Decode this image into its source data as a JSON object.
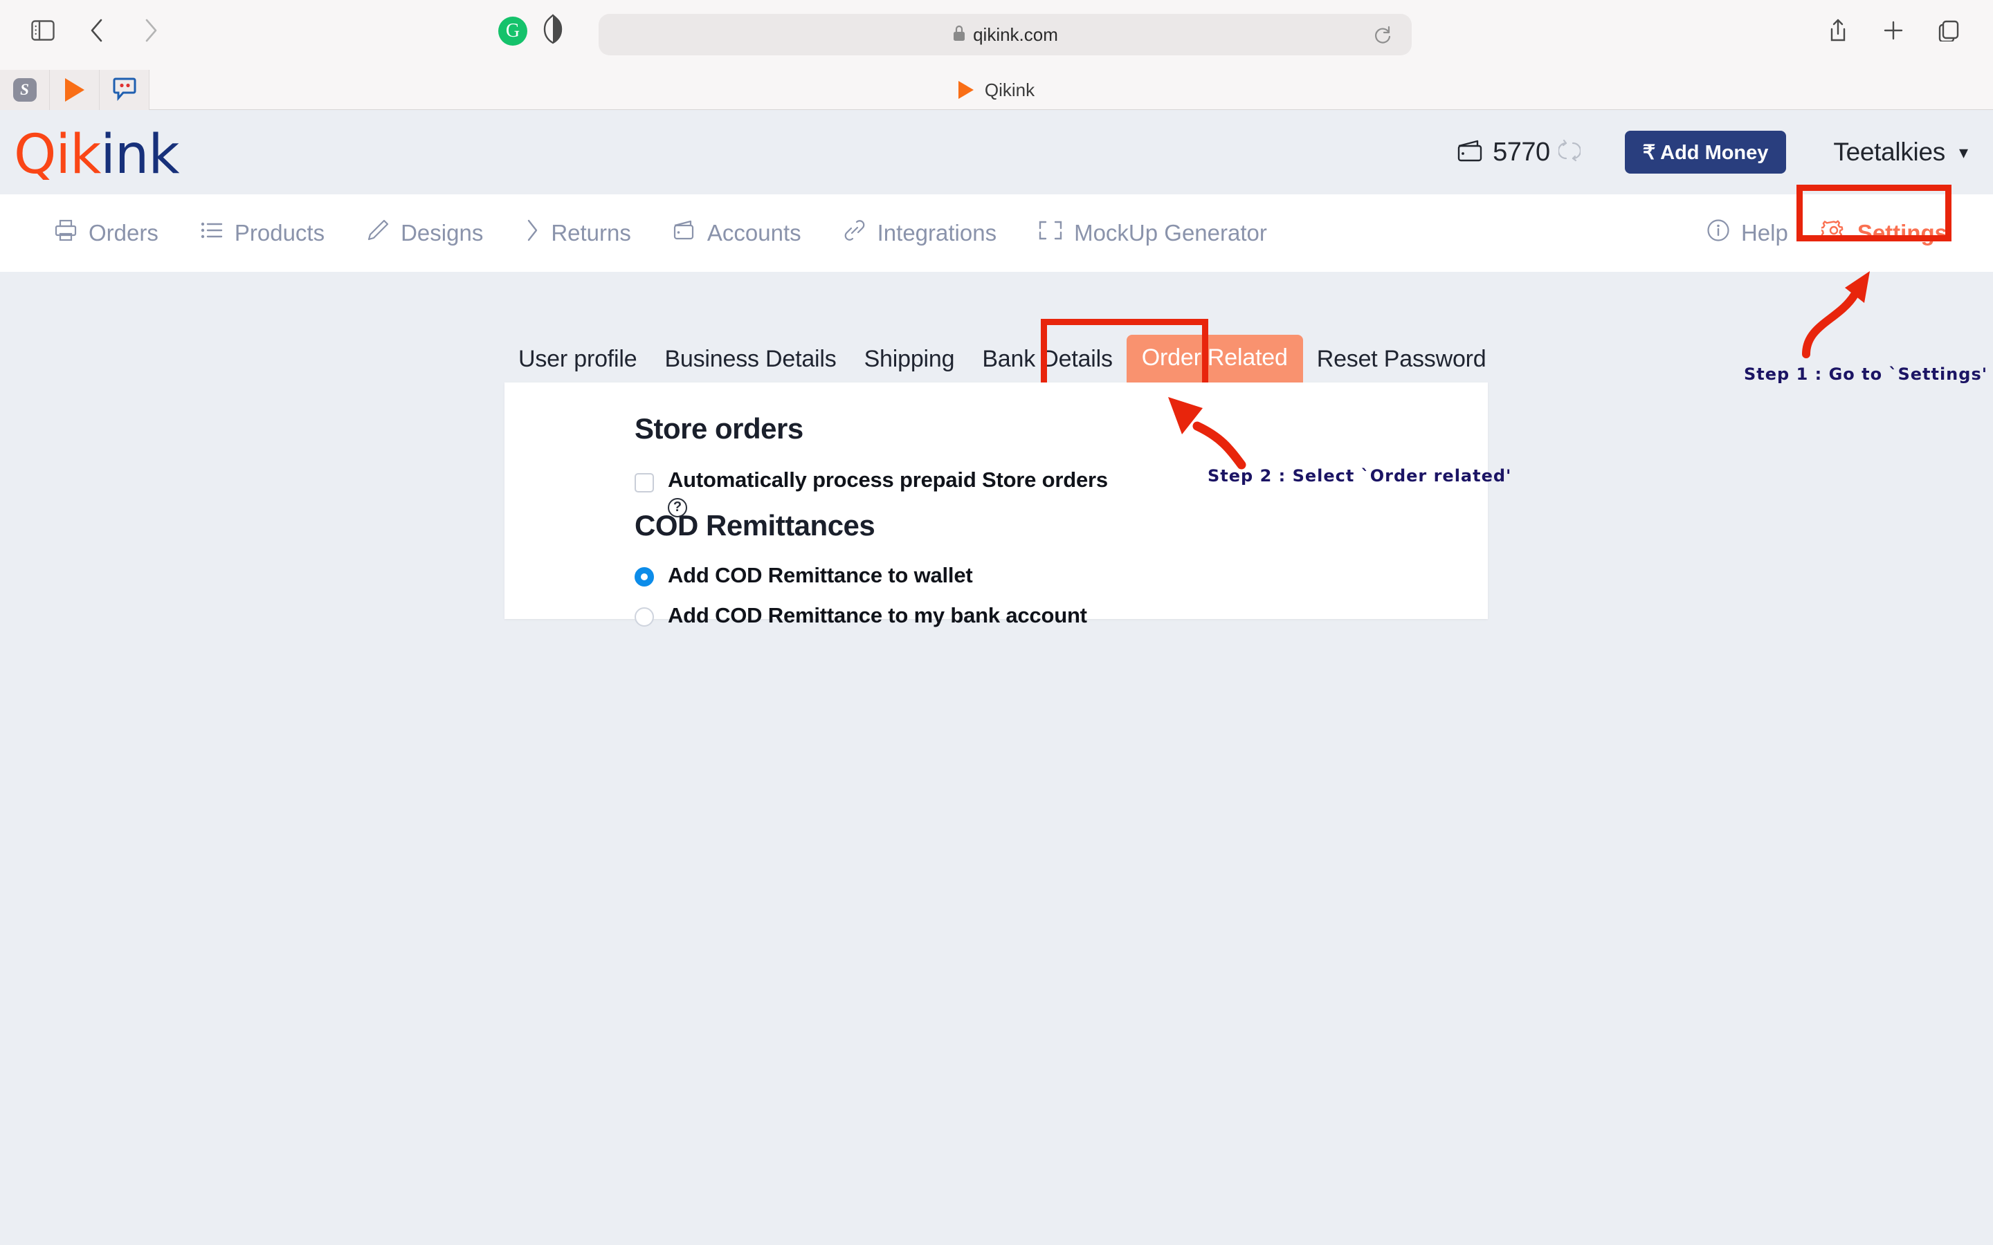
{
  "browser": {
    "url": "qikink.com",
    "lock_icon": "lock-icon",
    "reload_icon": "reload-icon",
    "sidebar_icon": "sidebar-toggle-icon",
    "back_icon": "chevron-left-icon",
    "forward_icon": "chevron-right-icon",
    "grammarly_icon": "G",
    "shield_icon": "privacy-shield-icon",
    "share_icon": "share-icon",
    "newtab_icon": "plus-icon",
    "tabs_icon": "tab-overview-icon",
    "extensions": [
      {
        "name": "stylebot-extension",
        "glyph": "S"
      },
      {
        "name": "video-downloader-extension",
        "glyph": "play"
      },
      {
        "name": "comment-extension",
        "glyph": "chat"
      }
    ],
    "tab": {
      "title": "Qikink",
      "favicon": "qikink-play-favicon"
    }
  },
  "header": {
    "logo_part1": "Qik",
    "logo_part2": "ink",
    "wallet": {
      "icon": "wallet-icon",
      "amount": "5770",
      "refresh_icon": "refresh-icon"
    },
    "add_money_label": "₹ Add Money",
    "user": {
      "name": "Teetalkies",
      "caret": "chevron-down-icon"
    }
  },
  "nav": {
    "items": [
      {
        "label": "Orders",
        "icon": "printer-icon"
      },
      {
        "label": "Products",
        "icon": "list-icon"
      },
      {
        "label": "Designs",
        "icon": "pencil-icon"
      },
      {
        "label": "Returns",
        "icon": "chevron-right-icon"
      },
      {
        "label": "Accounts",
        "icon": "wallet-icon"
      },
      {
        "label": "Integrations",
        "icon": "link-icon"
      },
      {
        "label": "MockUp Generator",
        "icon": "crop-frame-icon"
      }
    ],
    "help": {
      "label": "Help",
      "icon": "info-circle-icon"
    },
    "settings": {
      "label": "Settings",
      "icon": "gear-icon"
    }
  },
  "tabs": [
    {
      "label": "User profile",
      "active": false
    },
    {
      "label": "Business Details",
      "active": false
    },
    {
      "label": "Shipping",
      "active": false
    },
    {
      "label": "Bank Details",
      "active": false
    },
    {
      "label": "Order Related",
      "active": true
    },
    {
      "label": "Reset Password",
      "active": false
    }
  ],
  "main": {
    "store_orders": {
      "heading": "Store orders",
      "checkbox_label": "Automatically process prepaid Store orders",
      "checkbox_checked": false,
      "help_glyph": "?"
    },
    "cod": {
      "heading": "COD Remittances",
      "options": [
        {
          "label": "Add COD Remittance to wallet",
          "selected": true
        },
        {
          "label": "Add COD Remittance to my bank account",
          "selected": false
        }
      ]
    }
  },
  "annotations": [
    {
      "text": "Step 1 : Go to `Settings'"
    },
    {
      "text": "Step 2 : Select `Order related'"
    }
  ],
  "colors": {
    "brand_orange": "#FA4616",
    "brand_navy": "#17307A",
    "accent_salmon": "#F9926F",
    "highlight_red": "#E8250C",
    "radio_blue": "#0C8CE9",
    "page_bg": "#EBEEF3",
    "button_navy": "#293E7E"
  }
}
